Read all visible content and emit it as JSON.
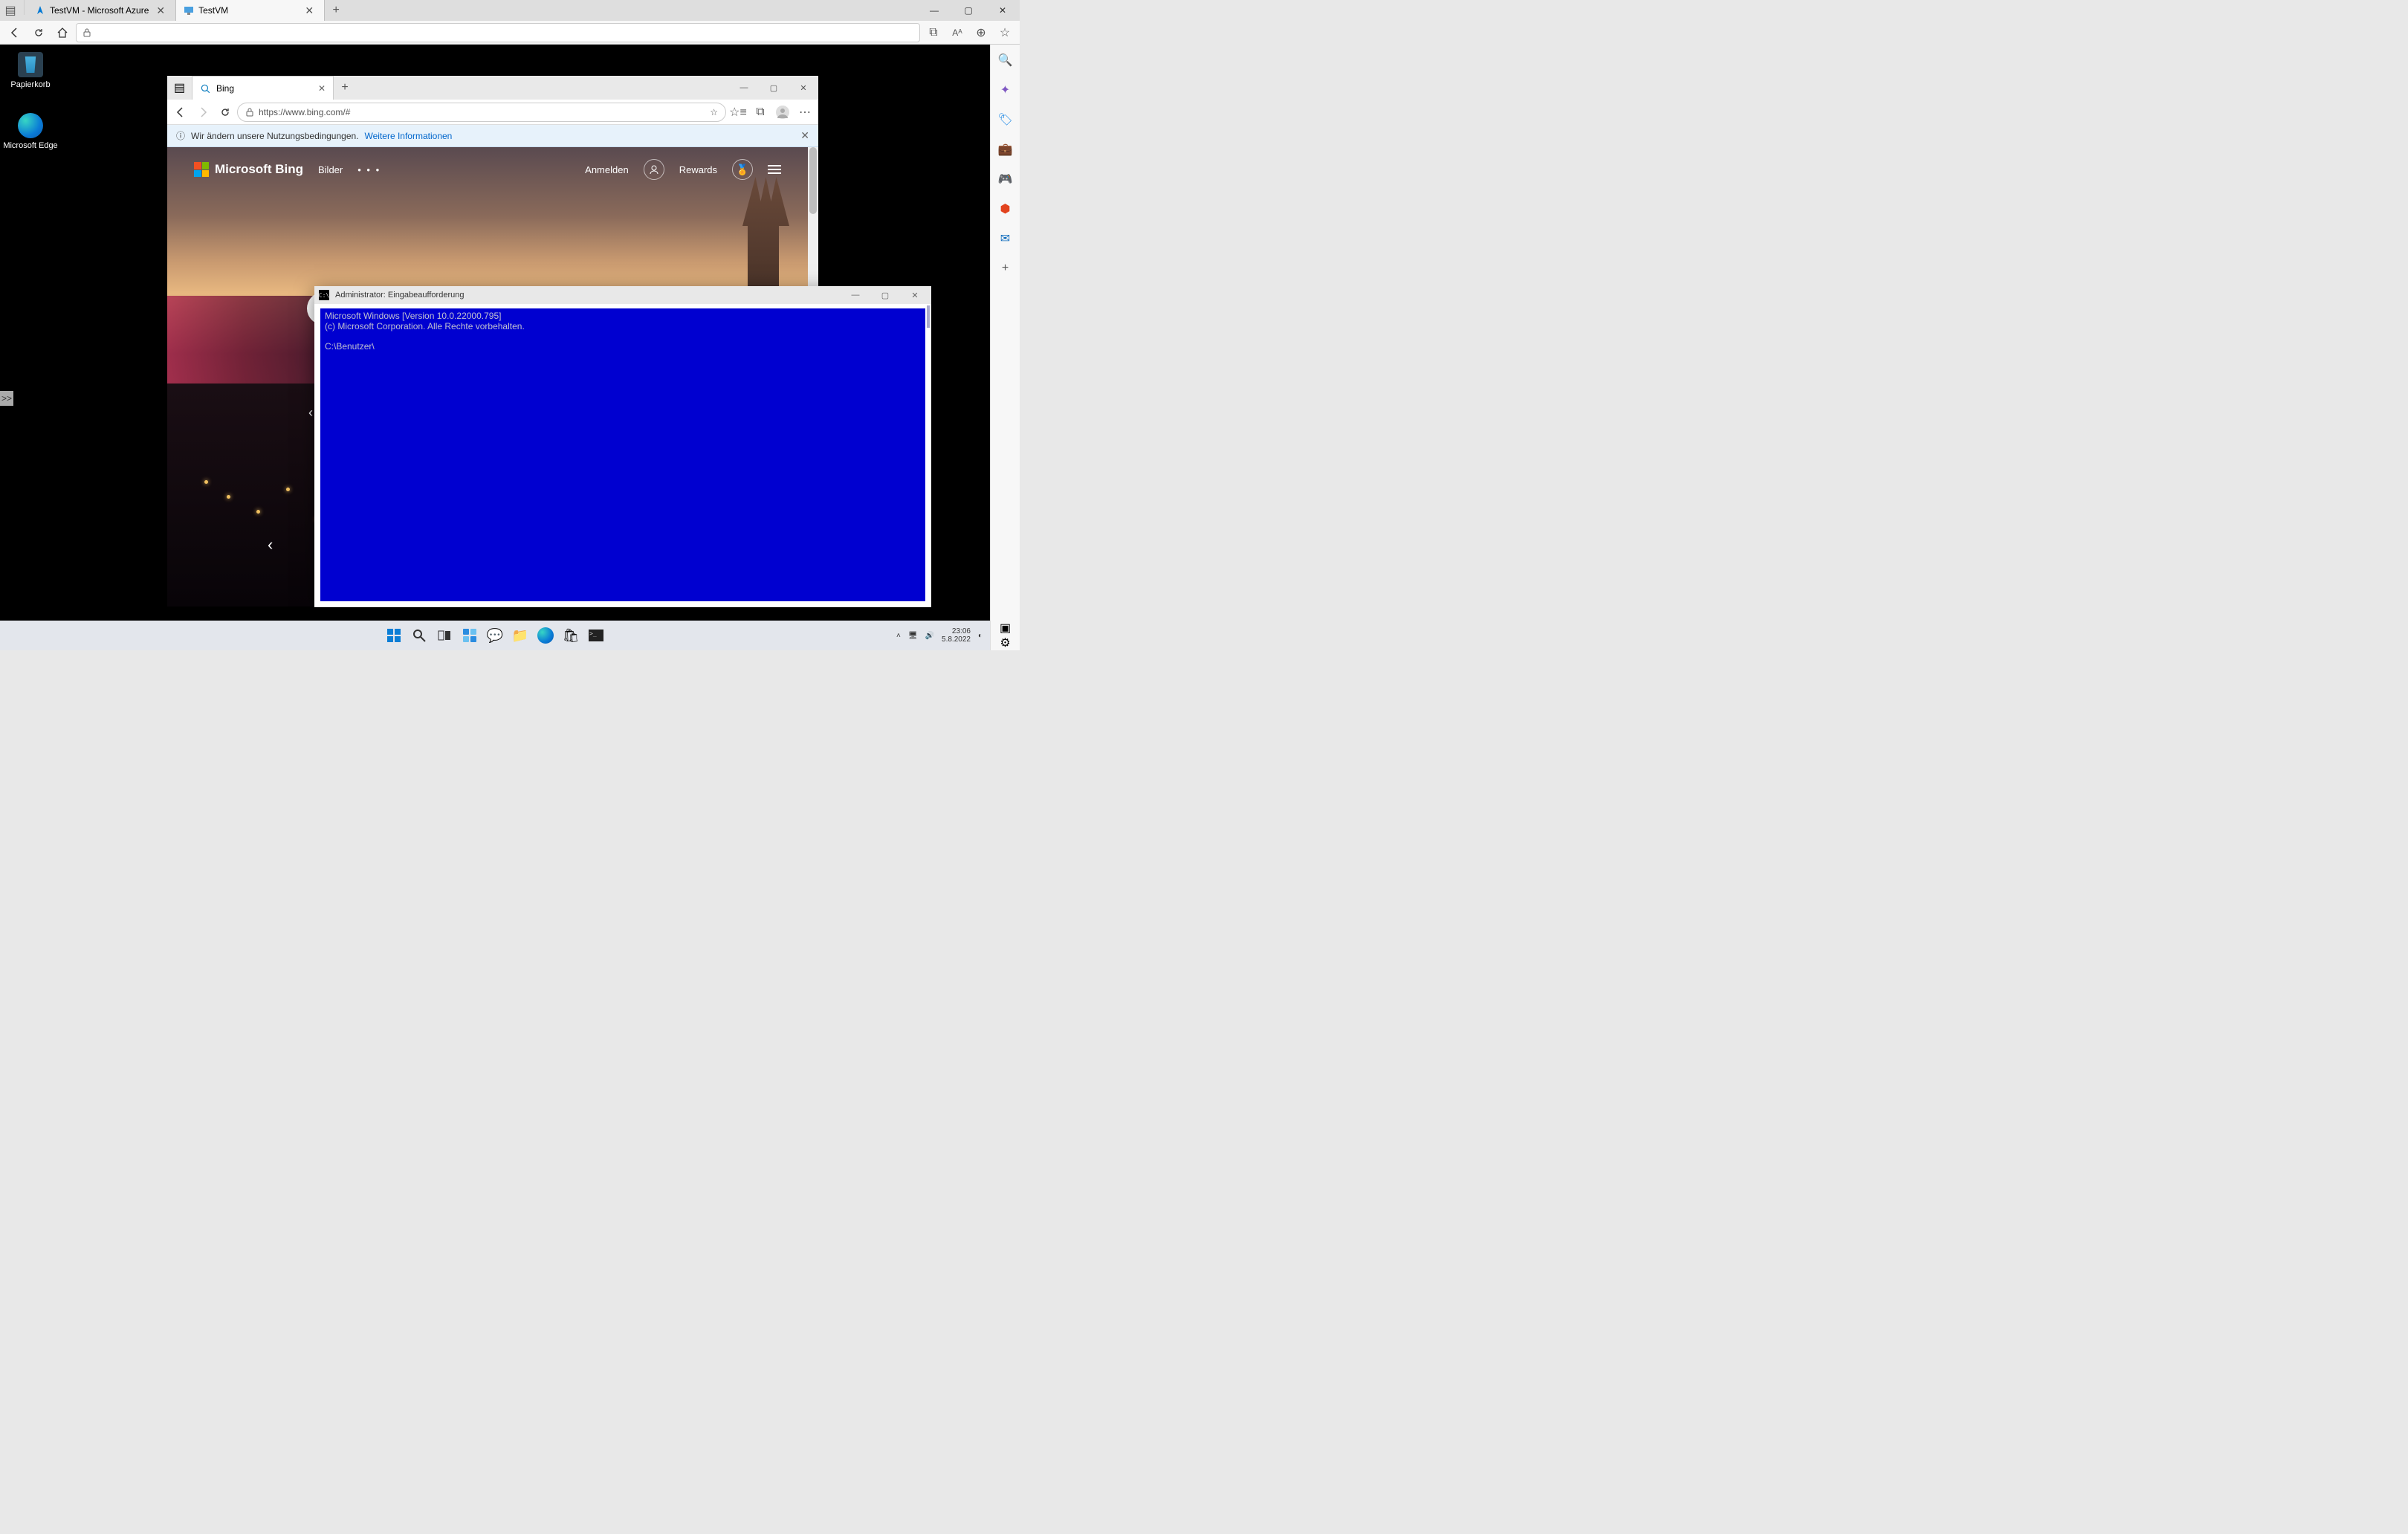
{
  "outer_browser": {
    "tabs": [
      {
        "title": "TestVM  - Microsoft Azure",
        "favicon": "azure"
      },
      {
        "title": "TestVM",
        "favicon": "vm"
      }
    ],
    "newtab": "+",
    "window_controls": {
      "min": "—",
      "max": "▢",
      "close": "✕"
    },
    "toolbar": {
      "back": "←",
      "forward": "→",
      "refresh": "⟳",
      "home": "⌂",
      "addr_lock": "🔒",
      "addr": "",
      "collections": "⧉",
      "read_aloud": "Aᴬ",
      "zoom": "⊕",
      "favorites": "☆"
    },
    "side_rail": [
      {
        "name": "search-icon",
        "glyph": "🔍",
        "color": "#0f6cbd"
      },
      {
        "name": "diamond-icon",
        "glyph": "✦",
        "color": "#7e57c2"
      },
      {
        "name": "tag-icon",
        "glyph": "🏷",
        "color": "#1e88e5"
      },
      {
        "name": "shopping-icon",
        "glyph": "💼",
        "color": "#f9a825"
      },
      {
        "name": "games-icon",
        "glyph": "🎮",
        "color": "#1e88e5"
      },
      {
        "name": "office-icon",
        "glyph": "⬢",
        "color": "#e2431e"
      },
      {
        "name": "outlook-icon",
        "glyph": "✉",
        "color": "#0f6cbd"
      },
      {
        "name": "add-icon",
        "glyph": "+",
        "color": "#555"
      }
    ],
    "side_corner": {
      "panel": "▣",
      "settings": "⚙"
    }
  },
  "desktop_icons": [
    {
      "name": "recycle-bin",
      "label": "Papierkorb"
    },
    {
      "name": "edge",
      "label": "Microsoft Edge"
    }
  ],
  "expander": ">>",
  "inner_edge": {
    "tab_title": "Bing",
    "newtab": "+",
    "window_controls": {
      "min": "—",
      "max": "▢",
      "close": "✕"
    },
    "toolbar": {
      "back": "←",
      "forward": "→",
      "refresh": "↻",
      "lock": "🔒",
      "url": "https://www.bing.com/#",
      "fav": "☆",
      "favs": "☆≡",
      "collections": "⧉",
      "profile": "◯",
      "menu": "⋯"
    },
    "infobar": {
      "icon": "ⓘ",
      "text": "Wir ändern unsere Nutzungsbedingungen.",
      "link": "Weitere Informationen",
      "close": "✕"
    }
  },
  "bing": {
    "logo_text": "Microsoft Bing",
    "nav_images": "Bilder",
    "nav_more": "• • •",
    "signin": "Anmelden",
    "rewards": "Rewards",
    "search_placeholder": "",
    "mic": "🎤",
    "lens": "[◉]",
    "search": "🔍"
  },
  "cmd": {
    "title": "Administrator: Eingabeaufforderung",
    "lines": [
      "Microsoft Windows [Version 10.0.22000.795]",
      "(c) Microsoft Corporation. Alle Rechte vorbehalten.",
      "",
      "C:\\Benutzer\\"
    ],
    "window_controls": {
      "min": "—",
      "max": "▢",
      "close": "✕"
    }
  },
  "taskbar": {
    "center": [
      {
        "name": "start-icon",
        "glyph": "⊞",
        "color": "#0a5bd6"
      },
      {
        "name": "search-icon",
        "glyph": "🔍",
        "color": "#333"
      },
      {
        "name": "taskview-icon",
        "glyph": "▥",
        "color": "#333"
      },
      {
        "name": "widgets-icon",
        "glyph": "◫",
        "color": "#0a7ed6"
      },
      {
        "name": "chat-icon",
        "glyph": "💬",
        "color": "#6264a7"
      },
      {
        "name": "explorer-icon",
        "glyph": "📁",
        "color": "#f0b030"
      },
      {
        "name": "edge-icon",
        "glyph": "●",
        "color": "#0a9bd6"
      },
      {
        "name": "store-icon",
        "glyph": "🛍",
        "color": "#333"
      },
      {
        "name": "terminal-icon",
        "glyph": "▪",
        "color": "#000"
      }
    ],
    "tray": {
      "chevron": "˄",
      "net": "🖥",
      "vol": "🔊",
      "time": "23:06",
      "date": "5.8.2022",
      "focus": "◐"
    }
  }
}
